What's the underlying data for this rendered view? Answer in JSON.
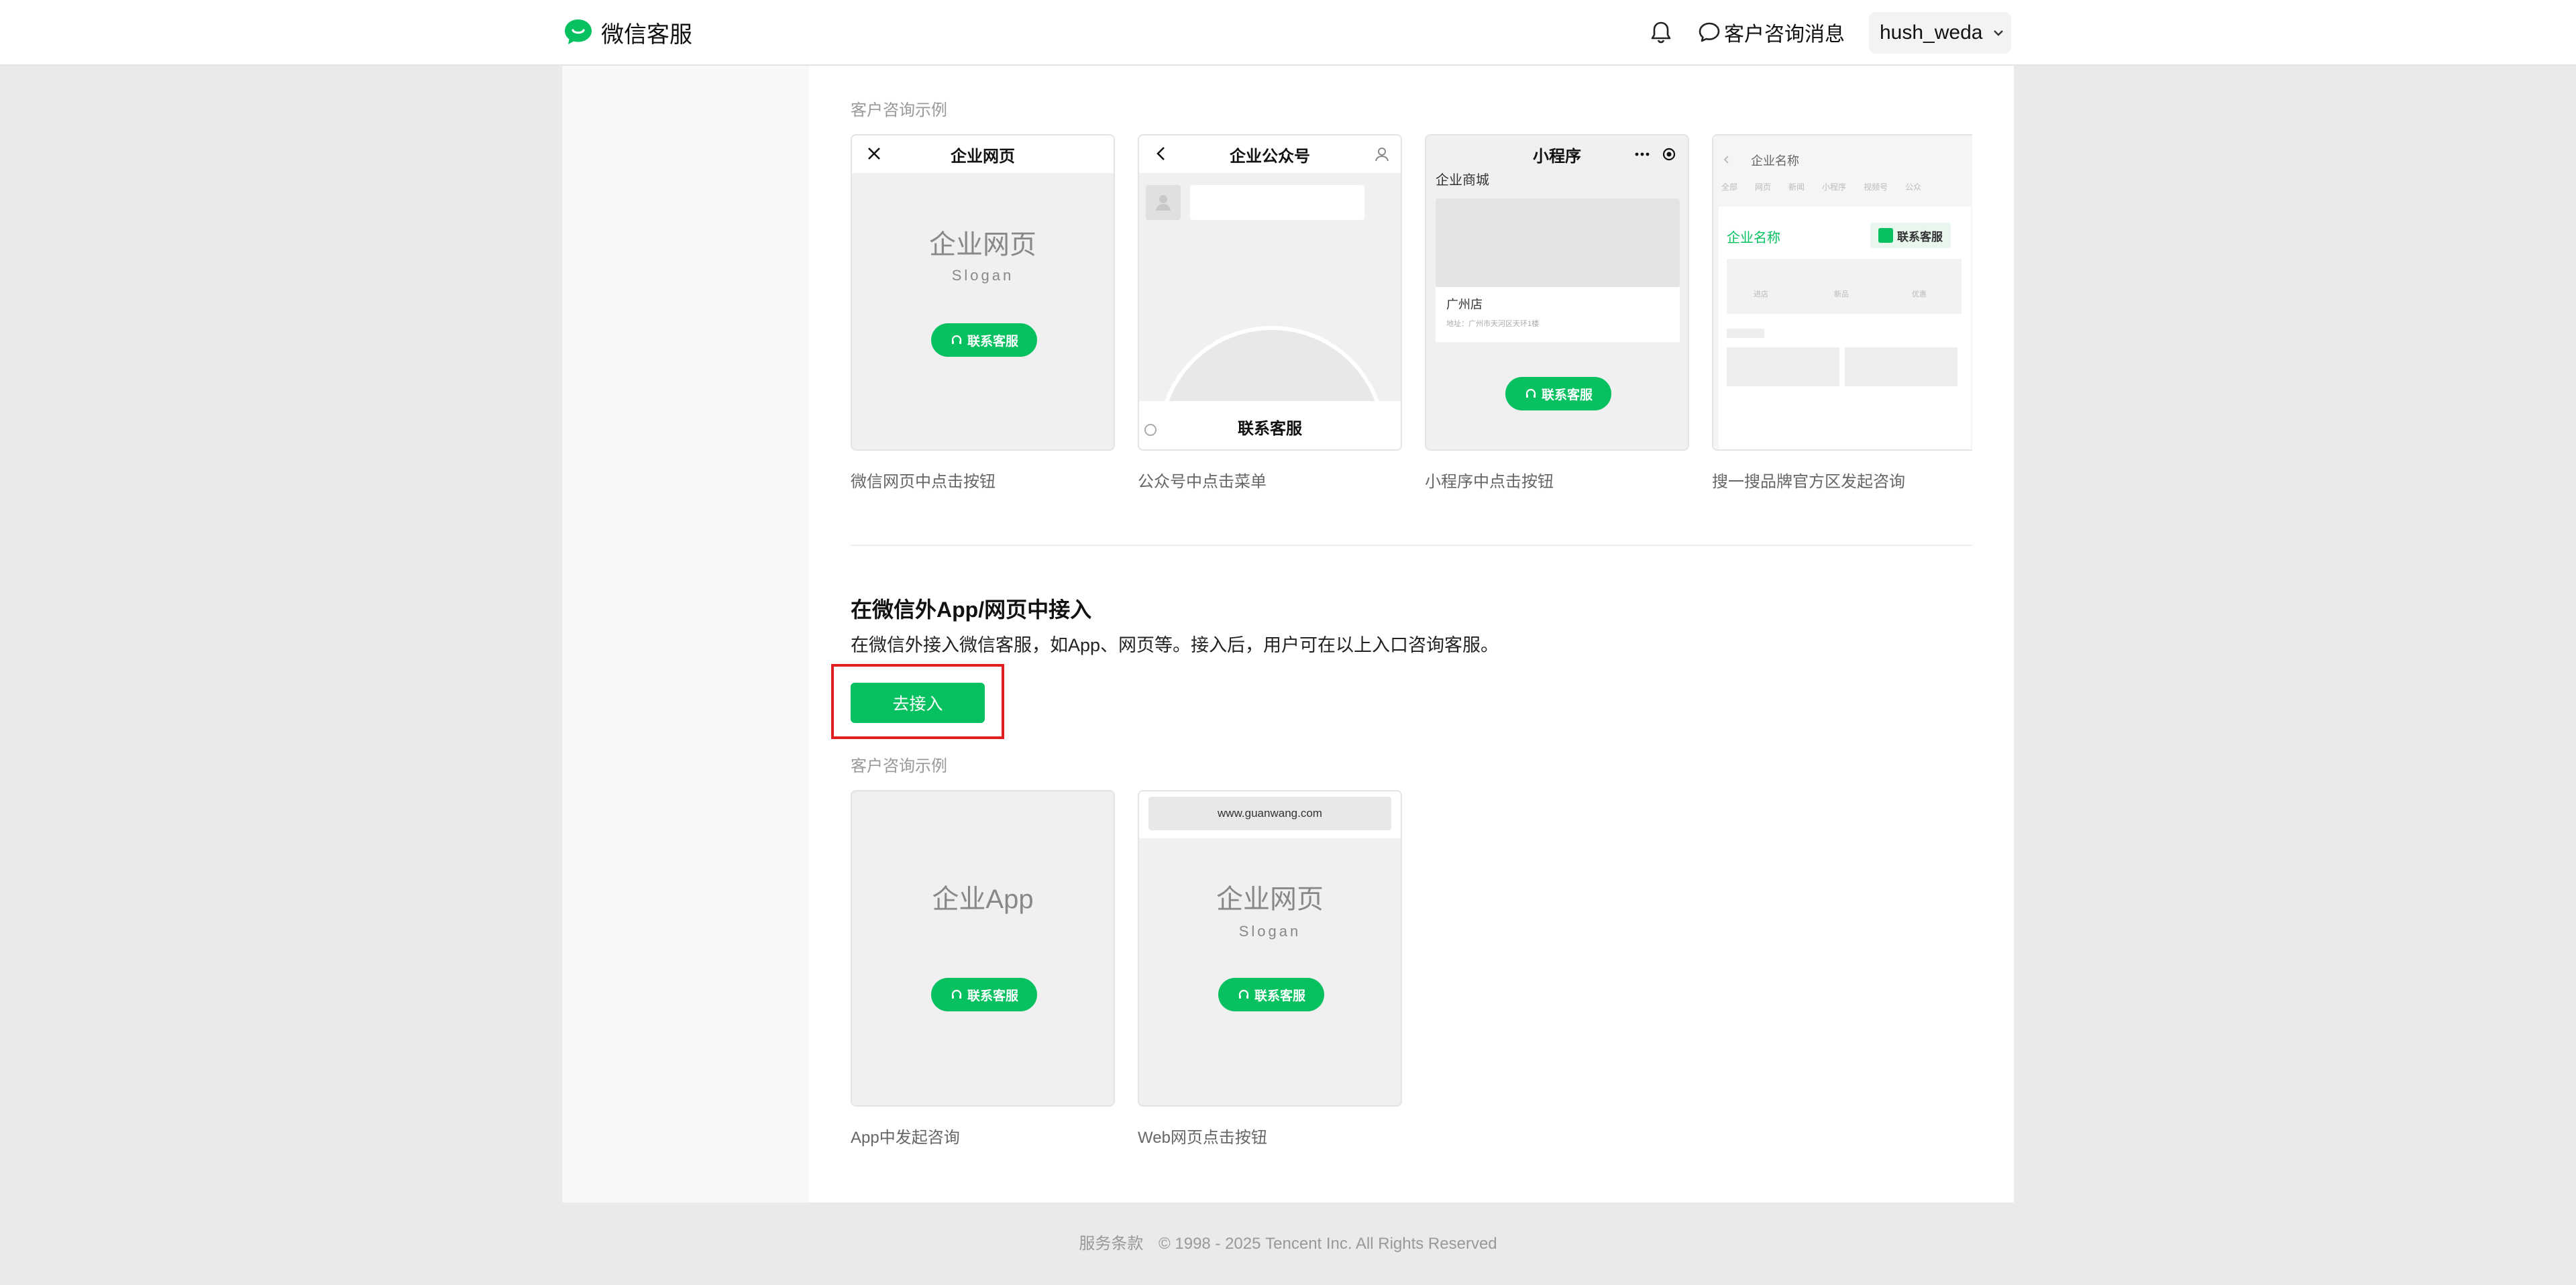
{
  "header": {
    "brand": "微信客服",
    "messages": "客户咨询消息",
    "user": "hush_weda"
  },
  "section1": {
    "example_caption": "客户咨询示例",
    "cards": [
      {
        "title": "企业网页",
        "big": "企业网页",
        "slogan": "Slogan",
        "button": "联系客服",
        "caption": "微信网页中点击按钮"
      },
      {
        "title": "企业公众号",
        "menu": "联系客服",
        "caption": "公众号中点击菜单"
      },
      {
        "title": "小程序",
        "shop": "企业商城",
        "store": "广州店",
        "address": "地址：广州市天河区天环1楼",
        "button": "联系客服",
        "caption": "小程序中点击按钮"
      },
      {
        "title": "企业名称",
        "tabs": [
          "全部",
          "网页",
          "新闻",
          "小程序",
          "视频号",
          "公众"
        ],
        "brand": "企业名称",
        "button": "联系客服",
        "icons": [
          "进店",
          "新品",
          "优惠"
        ],
        "caption": "搜一搜品牌官方区发起咨询"
      }
    ]
  },
  "section2": {
    "title": "在微信外App/网页中接入",
    "desc": "在微信外接入微信客服，如App、网页等。接入后，用户可在以上入口咨询客服。",
    "button": "去接入",
    "example_caption": "客户咨询示例",
    "cards": [
      {
        "big": "企业App",
        "button": "联系客服",
        "caption": "App中发起咨询"
      },
      {
        "url": "www.guanwang.com",
        "big": "企业网页",
        "slogan": "Slogan",
        "button": "联系客服",
        "caption": "Web网页点击按钮"
      }
    ]
  },
  "footer": {
    "terms": "服务条款",
    "copyright": "© 1998 - 2025 Tencent Inc. All Rights Reserved"
  },
  "colors": {
    "accent": "#07c160",
    "highlight": "#e02020"
  }
}
